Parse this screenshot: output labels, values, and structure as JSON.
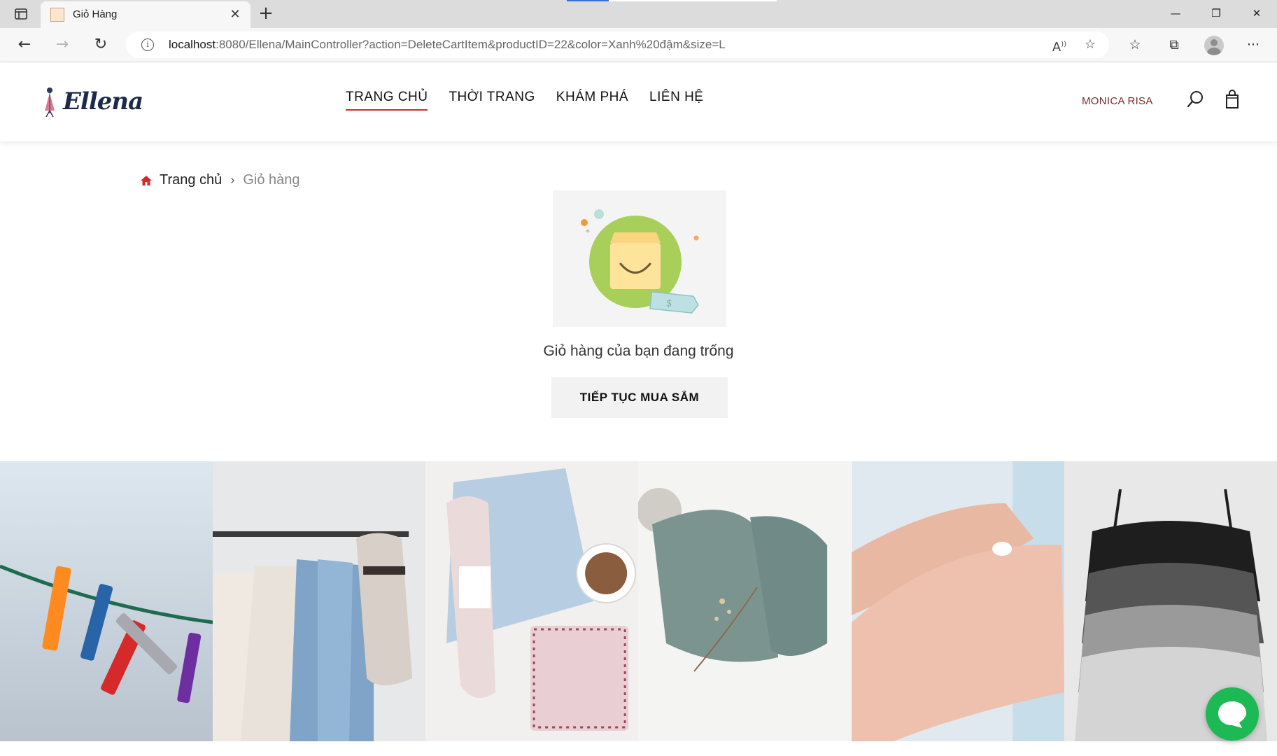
{
  "browser": {
    "tab_title": "Giỏ Hàng",
    "url_host": "localhost",
    "url_rest": ":8080/Ellena/MainController?action=DeleteCartItem&productID=22&color=Xanh%20đậm&size=L"
  },
  "site": {
    "logo_text": "Ellena",
    "nav": [
      {
        "label": "TRANG CHỦ"
      },
      {
        "label": "THỜI TRANG"
      },
      {
        "label": "KHÁM PHÁ"
      },
      {
        "label": "LIÊN HỆ"
      }
    ],
    "user_name": "MONICA RISA"
  },
  "breadcrumb": {
    "home": "Trang chủ",
    "current": "Giỏ hàng"
  },
  "cart": {
    "empty_message": "Giỏ hàng của bạn đang trống",
    "continue_label": "TIẾP TỤC MUA SẮM"
  },
  "colors": {
    "accent_red": "#d02b2b",
    "chat_green": "#1db954",
    "user_name": "#7a2a2a"
  },
  "gallery": [
    {
      "subject": "clothespins-on-line"
    },
    {
      "subject": "clothes-rack-with-hat"
    },
    {
      "subject": "yarn-jeans-coffee"
    },
    {
      "subject": "knit-baby-hat"
    },
    {
      "subject": "hands-applying-cream"
    },
    {
      "subject": "stacked-camisoles"
    }
  ]
}
